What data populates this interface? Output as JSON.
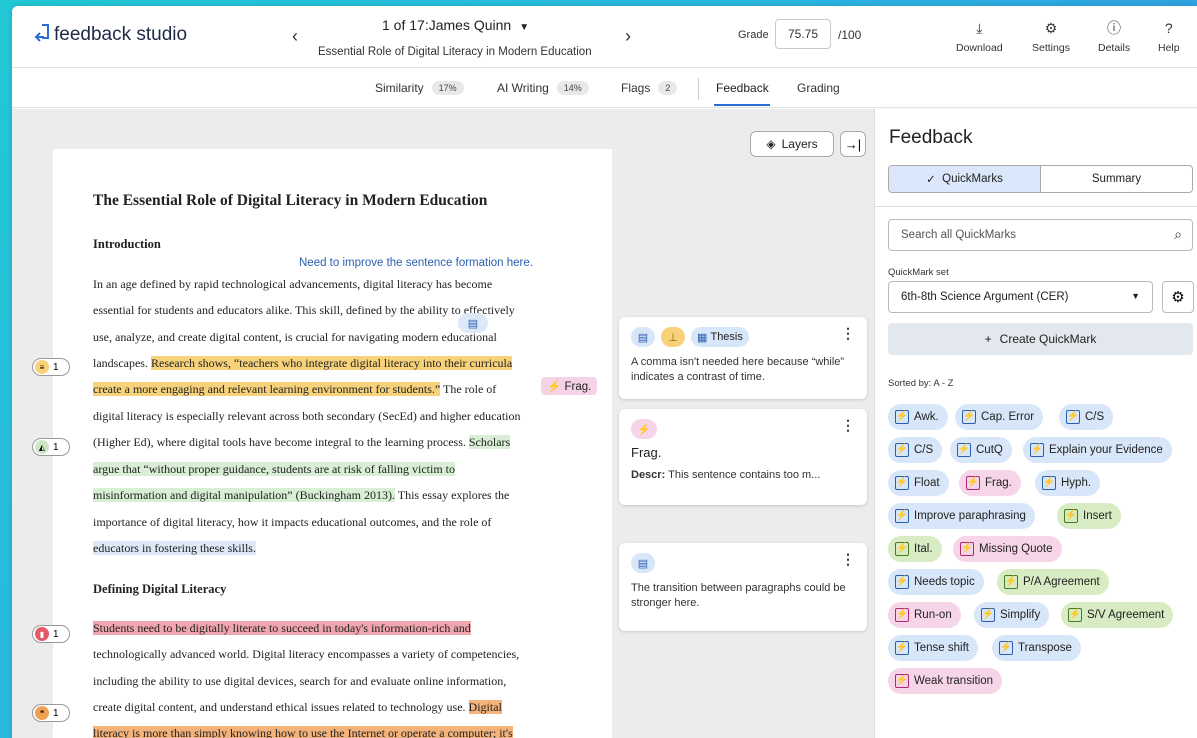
{
  "app": {
    "name": "feedback studio"
  },
  "header": {
    "student": "1 of 17:James Quinn",
    "paper_title": "Essential Role of Digital Literacy in Modern Education",
    "grade_label": "Grade",
    "grade_value": "75.75",
    "grade_max": "/100",
    "buttons": {
      "download": "Download",
      "settings": "Settings",
      "details": "Details",
      "help": "Help"
    }
  },
  "tabs": {
    "similarity": "Similarity",
    "similarity_pct": "17%",
    "ai_writing": "AI Writing",
    "ai_pct": "14%",
    "flags": "Flags",
    "flags_count": "2",
    "feedback": "Feedback",
    "grading": "Grading"
  },
  "toolbar": {
    "layers": "Layers"
  },
  "paper": {
    "title": "The Essential Role of Digital Literacy in Modern Education",
    "intro_heading": "Introduction",
    "inline_note": "Need to improve the sentence formation here.",
    "frag_tag": "Frag.",
    "lines": {
      "l1": "In an age defined by rapid technological advancements, digital literacy has become",
      "l2": "essential for students and educators alike. This skill, defined by the ability to effectively",
      "l3": "use, analyze, and create digital content, is crucial for navigating modern educational",
      "l4a": "landscapes. ",
      "l4b": "Research shows, “teachers who integrate digital literacy into their curricula",
      "l5a": "create a more engaging and relevant learning environment for students.”",
      "l5b": " The role of",
      "l6": "digital literacy is especially relevant across both secondary (SecEd) and higher education",
      "l7a": "(Higher Ed), where digital tools have become integral to the learning process. ",
      "l7b": "Scholars",
      "l8": "argue that “without proper guidance, students are at risk of falling victim to",
      "l9a": "misinformation and digital manipulation” (Buckingham 2013).",
      "l9b": " This essay explores the",
      "l10": "importance of digital literacy, how it impacts educational outcomes, and the role of",
      "l11": "educators in fostering these skills.",
      "l12": "Students need to be digitally literate to succeed in today's information-rich and",
      "l13": "technologically advanced world. Digital literacy encompasses a variety of competencies,",
      "l14": "including the ability to use digital devices, search for and evaluate online information,",
      "l15a": "create digital content, and understand ethical issues related to technology use. ",
      "l15b": "Digital",
      "l16": "literacy is more than simply knowing how to use the Internet or operate a computer; it's"
    },
    "section2_heading": "Defining Digital Literacy",
    "margin_counts": [
      "1",
      "1",
      "1",
      "1"
    ]
  },
  "cards": [
    {
      "tag": "Thesis",
      "text": "A comma isn't needed here because “while” indicates a contrast of time."
    },
    {
      "head": "Frag.",
      "descr_label": "Descr:",
      "descr": "This sentence contains too m..."
    },
    {
      "text": "The transition between paragraphs could be stronger here."
    }
  ],
  "panel": {
    "title": "Feedback",
    "seg_quickmarks": "QuickMarks",
    "seg_summary": "Summary",
    "search_placeholder": "Search all QuickMarks",
    "set_label": "QuickMark set",
    "set_value": "6th-8th Science Argument (CER)",
    "create": "Create QuickMark",
    "sorted": "Sorted by: A - Z",
    "quickmarks": [
      "Awk.",
      "Cap. Error",
      "C/S",
      "C/S",
      "CutQ",
      "Explain your Evidence",
      "Float",
      "Frag.",
      "Hyph.",
      "Improve paraphrasing",
      "Insert",
      "Ital.",
      "Missing Quote",
      "Needs topic",
      "P/A Agreement",
      "Run-on",
      "Simplify",
      "S/V Agreement",
      "Tense shift",
      "Transpose",
      "Weak transition"
    ]
  }
}
